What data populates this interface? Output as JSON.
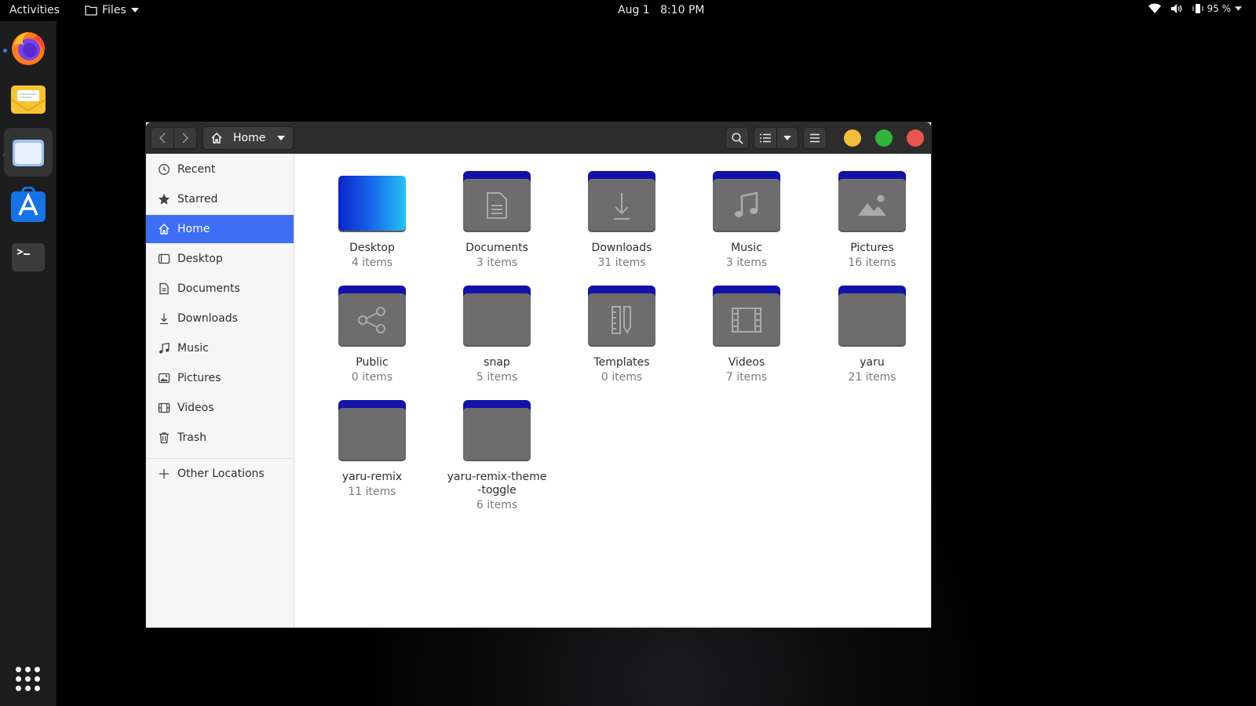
{
  "topbar": {
    "activities": "Activities",
    "app_menu": "Files",
    "date": "Aug 1",
    "time": "8:10 PM",
    "battery": "95 %"
  },
  "dock": {
    "items": [
      "firefox-icon",
      "mail-icon",
      "files-icon",
      "software-icon",
      "terminal-icon",
      "show-apps-icon"
    ]
  },
  "window": {
    "path_label": "Home",
    "controls": {
      "minimize_color": "#f5bd3d",
      "maximize_color": "#2fb53a",
      "close_color": "#e9554f"
    }
  },
  "sidebar": {
    "items": [
      {
        "label": "Recent",
        "icon": "clock-icon"
      },
      {
        "label": "Starred",
        "icon": "star-icon"
      },
      {
        "label": "Home",
        "icon": "home-icon",
        "selected": true
      },
      {
        "label": "Desktop",
        "icon": "desktop-icon"
      },
      {
        "label": "Documents",
        "icon": "document-icon"
      },
      {
        "label": "Downloads",
        "icon": "download-icon"
      },
      {
        "label": "Music",
        "icon": "music-icon"
      },
      {
        "label": "Pictures",
        "icon": "picture-icon"
      },
      {
        "label": "Videos",
        "icon": "video-icon"
      },
      {
        "label": "Trash",
        "icon": "trash-icon"
      }
    ],
    "other_locations": "Other Locations"
  },
  "files": [
    {
      "name": "Desktop",
      "count": "4 items"
    },
    {
      "name": "Documents",
      "count": "3 items"
    },
    {
      "name": "Downloads",
      "count": "31 items"
    },
    {
      "name": "Music",
      "count": "3 items"
    },
    {
      "name": "Pictures",
      "count": "16 items"
    },
    {
      "name": "Public",
      "count": "0 items"
    },
    {
      "name": "snap",
      "count": "5 items"
    },
    {
      "name": "Templates",
      "count": "0 items"
    },
    {
      "name": "Videos",
      "count": "7 items"
    },
    {
      "name": "yaru",
      "count": "21 items"
    },
    {
      "name": "yaru-remix",
      "count": "11 items"
    },
    {
      "name": "yaru-remix-theme-toggle",
      "count": "6 items"
    }
  ],
  "accent_color": "#3d6ef5"
}
